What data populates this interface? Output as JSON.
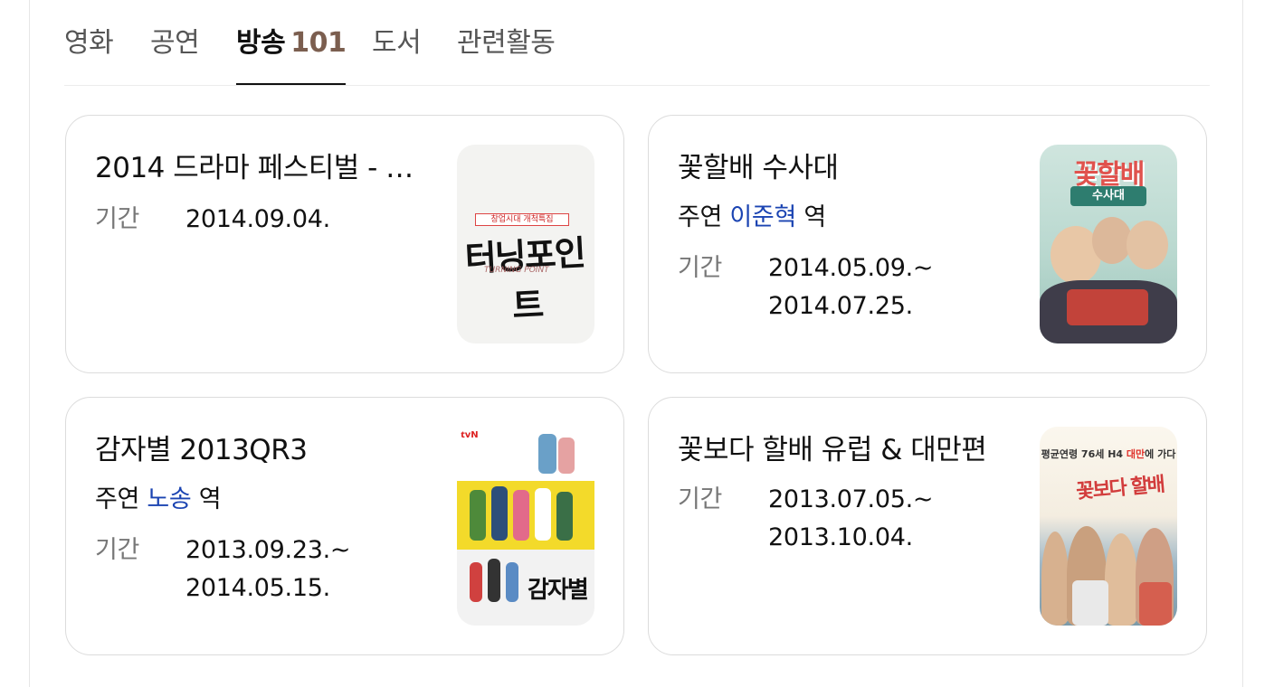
{
  "tabs": [
    {
      "label": "영화",
      "active": false
    },
    {
      "label": "공연",
      "active": false
    },
    {
      "label": "방송",
      "count": "101",
      "active": true
    },
    {
      "label": "도서",
      "active": false
    },
    {
      "label": "관련활동",
      "active": false
    }
  ],
  "cards": [
    {
      "title": "2014 드라마 페스티벌 - …",
      "period_label": "기간",
      "period_lines": [
        "2014.09.04."
      ],
      "poster": {
        "tag": "창업시대 개척특집",
        "title": "터닝포인트",
        "sub": "TURNING POINT"
      }
    },
    {
      "title": "꽃할배 수사대",
      "role_label": "주연",
      "role_name": "이준혁",
      "role_suffix": "역",
      "period_label": "기간",
      "period_lines": [
        "2014.05.09.~",
        "2014.07.25."
      ],
      "poster": {
        "title": "꽃할배",
        "sub": "수사대"
      }
    },
    {
      "title": "감자별 2013QR3",
      "role_label": "주연",
      "role_name": "노송",
      "role_suffix": "역",
      "period_label": "기간",
      "period_lines": [
        "2013.09.23.~",
        "2014.05.15."
      ],
      "poster": {
        "brand": "tvN",
        "title": "감자별"
      }
    },
    {
      "title": "꽃보다 할배 유럽 & 대만편",
      "period_label": "기간",
      "period_lines": [
        "2013.07.05.~",
        "2013.10.04."
      ],
      "poster": {
        "header": "평균연령 76세 H4",
        "header_em": "대만",
        "header_tail": "에 가다",
        "title": "꽃보다 할배"
      }
    }
  ],
  "colors": {
    "link": "#1b44b2",
    "count": "#7b5e4f",
    "border": "#dcdcdc"
  }
}
